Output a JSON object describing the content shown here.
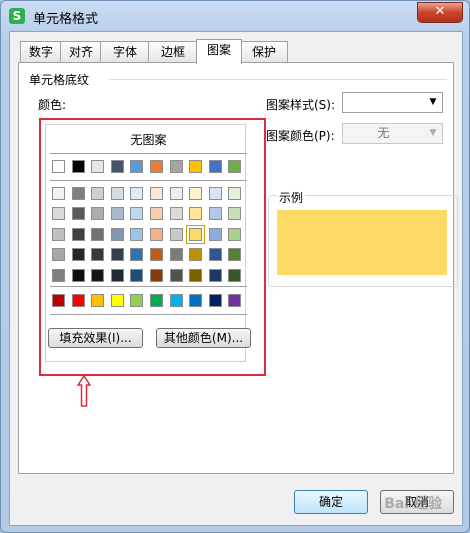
{
  "window": {
    "title": "单元格格式",
    "close_label": "✕"
  },
  "tabs": [
    {
      "label": "数字"
    },
    {
      "label": "对齐"
    },
    {
      "label": "字体"
    },
    {
      "label": "边框"
    },
    {
      "label": "图案"
    },
    {
      "label": "保护"
    }
  ],
  "active_tab": "图案",
  "group": {
    "title": "单元格底纹"
  },
  "color_label": "颜色:",
  "picker": {
    "no_pattern_label": "无图案",
    "row_top": [
      "#ffffff",
      "#000000",
      "#e7e6e6",
      "#44546a",
      "#5b9bd5",
      "#ed7d31",
      "#a5a5a5",
      "#ffc000",
      "#4472c4",
      "#70ad47"
    ],
    "grid": [
      [
        "#f2f2f2",
        "#7f7f7f",
        "#d0cece",
        "#d6dce4",
        "#deebf7",
        "#fbe5d6",
        "#ededed",
        "#fff2cc",
        "#dae3f3",
        "#e2f0d9"
      ],
      [
        "#d9d9d9",
        "#595959",
        "#aeabab",
        "#adb9ca",
        "#bdd7ee",
        "#f8cbad",
        "#dbdbdb",
        "#ffe699",
        "#b4c7e7",
        "#c5e0b4"
      ],
      [
        "#bfbfbf",
        "#404040",
        "#757171",
        "#8497b0",
        "#9dc3e6",
        "#f4b183",
        "#c9c9c9",
        "#ffd966",
        "#8faadc",
        "#a9d18e"
      ],
      [
        "#a6a6a6",
        "#262626",
        "#3a3838",
        "#333f50",
        "#2e75b6",
        "#c55a11",
        "#7b7b7b",
        "#bf9000",
        "#2f5597",
        "#548235"
      ],
      [
        "#808080",
        "#0d0d0d",
        "#171616",
        "#222a35",
        "#1f4e79",
        "#843c0c",
        "#525252",
        "#7f6000",
        "#203864",
        "#385723"
      ]
    ],
    "row_standard": [
      "#c00000",
      "#ff0000",
      "#ffc000",
      "#ffff00",
      "#92d050",
      "#00b050",
      "#00b0f0",
      "#0070c0",
      "#002060",
      "#7030a0"
    ],
    "selected": "#ffd966",
    "fill_effects_label": "填充效果(I)...",
    "more_colors_label": "其他颜色(M)..."
  },
  "pattern_style": {
    "label": "图案样式(S):",
    "value": ""
  },
  "pattern_color": {
    "label": "图案颜色(P):",
    "value": "无"
  },
  "sample": {
    "label": "示例",
    "color": "#ffd966"
  },
  "footer": {
    "ok_label": "确定",
    "cancel_label": "取消"
  },
  "watermark": "Bai 经验"
}
